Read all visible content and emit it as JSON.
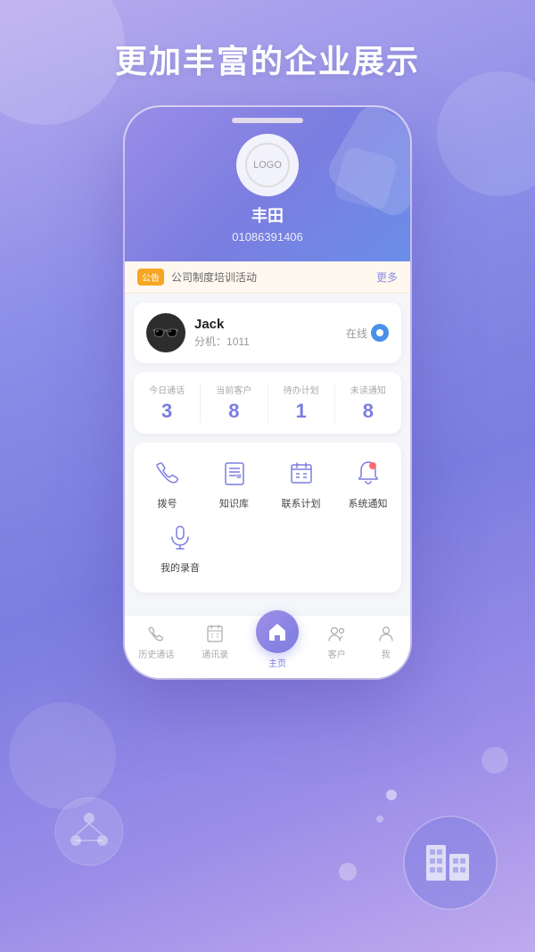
{
  "page": {
    "title": "更加丰富的企业展示"
  },
  "company": {
    "logo_text": "LOGO",
    "name": "丰田",
    "phone": "01086391406"
  },
  "notice": {
    "badge": "公告",
    "text": "公司制度培训活动",
    "more": "更多"
  },
  "user": {
    "name": "Jack",
    "ext_label": "分机：",
    "ext_number": "1011",
    "status": "在线"
  },
  "stats": [
    {
      "label": "今日通话",
      "value": "3"
    },
    {
      "label": "当前客户",
      "value": "8"
    },
    {
      "label": "待办计划",
      "value": "1"
    },
    {
      "label": "未读通知",
      "value": "8"
    }
  ],
  "menu": {
    "items": [
      {
        "id": "dial",
        "label": "拨号",
        "icon": "dial"
      },
      {
        "id": "knowledge",
        "label": "知识库",
        "icon": "knowledge"
      },
      {
        "id": "contact-plan",
        "label": "联系计划",
        "icon": "contact-plan"
      },
      {
        "id": "notification",
        "label": "系统通知",
        "icon": "notification"
      },
      {
        "id": "recording",
        "label": "我的录音",
        "icon": "recording"
      }
    ]
  },
  "bottom_nav": [
    {
      "id": "history",
      "label": "历史通话",
      "active": false
    },
    {
      "id": "contacts",
      "label": "通讯录",
      "active": false
    },
    {
      "id": "home",
      "label": "主页",
      "active": true
    },
    {
      "id": "customers",
      "label": "客户",
      "active": false
    },
    {
      "id": "me",
      "label": "我",
      "active": false
    }
  ],
  "colors": {
    "primary": "#7b7de0",
    "accent": "#8b8de8",
    "online": "#4a90e8"
  }
}
